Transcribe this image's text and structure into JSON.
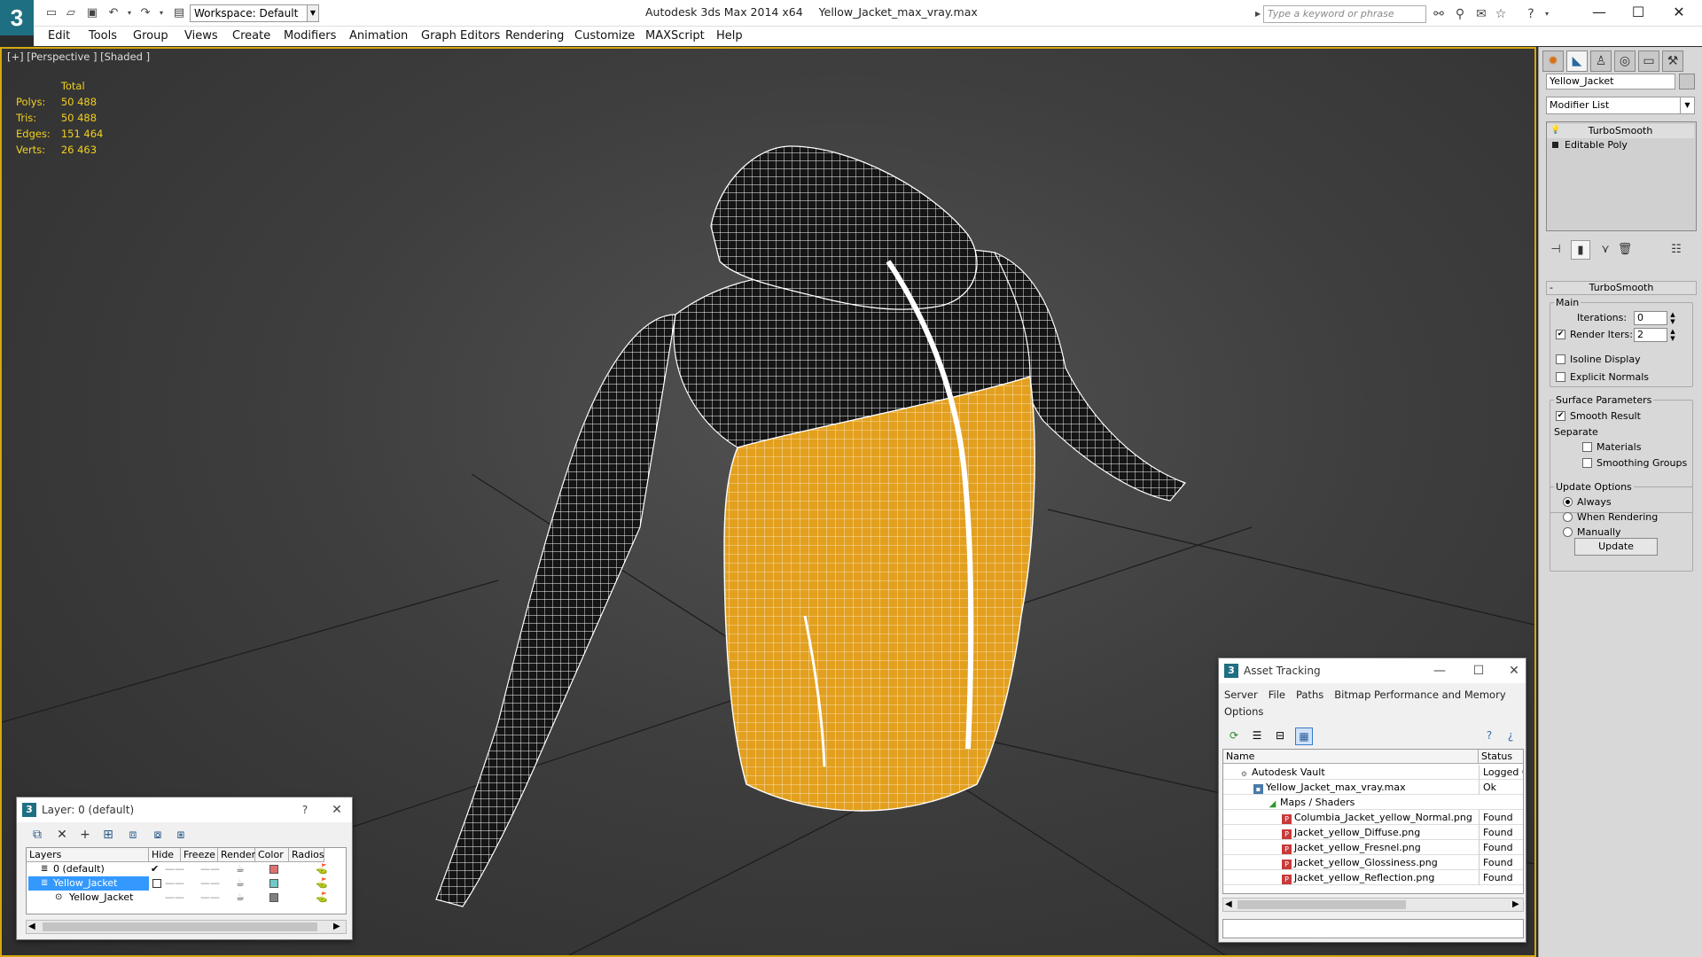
{
  "titlebar": {
    "app_name": "Autodesk 3ds Max  2014 x64",
    "file_name": "Yellow_Jacket_max_vray.max",
    "workspace": "Workspace: Default",
    "search_placeholder": "Type a keyword or phrase",
    "logo_glyph": "3"
  },
  "menu": [
    "Edit",
    "Tools",
    "Group",
    "Views",
    "Create",
    "Modifiers",
    "Animation",
    "Graph Editors",
    "Rendering",
    "Customize",
    "MAXScript",
    "Help"
  ],
  "viewport": {
    "label": "[+] [Perspective ] [Shaded ]",
    "stats": {
      "header": "Total",
      "rows": [
        {
          "label": "Polys:",
          "value": "50 488"
        },
        {
          "label": "Tris:",
          "value": "50 488"
        },
        {
          "label": "Edges:",
          "value": "151 464"
        },
        {
          "label": "Verts:",
          "value": "26 463"
        }
      ]
    },
    "accent": "#d4a810",
    "jacket_body_color": "#e3a01e"
  },
  "command_panel": {
    "object_name": "Yellow_Jacket",
    "modifier_list": "Modifier List",
    "stack": [
      "TurboSmooth",
      "Editable Poly"
    ],
    "rollout_title": "TurboSmooth",
    "main_label": "Main",
    "iterations_label": "Iterations:",
    "iterations_value": "0",
    "render_iters_label": "Render Iters:",
    "render_iters_value": "2",
    "isoline_label": "Isoline Display",
    "explicit_normals_label": "Explicit Normals",
    "surface_params_label": "Surface Parameters",
    "smooth_result_label": "Smooth Result",
    "separate_label": "Separate",
    "materials_label": "Materials",
    "smoothing_groups_label": "Smoothing Groups",
    "update_options_label": "Update Options",
    "always_label": "Always",
    "when_rendering_label": "When Rendering",
    "manually_label": "Manually",
    "update_button": "Update"
  },
  "layer_window": {
    "title": "Layer: 0 (default)",
    "help": "?",
    "columns": [
      "Layers",
      "Hide",
      "Freeze",
      "Render",
      "Color",
      "Radiosi"
    ],
    "rows": [
      {
        "name": "0 (default)",
        "color": "#e07070",
        "current": true,
        "selected": false,
        "indent": 0
      },
      {
        "name": "Yellow_Jacket",
        "color": "#70c8c8",
        "current": false,
        "selected": true,
        "indent": 0
      },
      {
        "name": "Yellow_Jacket",
        "color": "#808080",
        "current": false,
        "selected": false,
        "indent": 1
      }
    ]
  },
  "asset_window": {
    "title": "Asset Tracking",
    "menus": [
      "Server",
      "File",
      "Paths",
      "Bitmap Performance and Memory",
      "Options"
    ],
    "columns": [
      "Name",
      "Status"
    ],
    "rows": [
      {
        "name": "Autodesk Vault",
        "status": "Logged O",
        "indent": 0
      },
      {
        "name": "Yellow_Jacket_max_vray.max",
        "status": "Ok",
        "indent": 1
      },
      {
        "name": "Maps / Shaders",
        "status": "",
        "indent": 2
      },
      {
        "name": "Columbia_Jacket_yellow_Normal.png",
        "status": "Found",
        "indent": 3
      },
      {
        "name": "Jacket_yellow_Diffuse.png",
        "status": "Found",
        "indent": 3
      },
      {
        "name": "Jacket_yellow_Fresnel.png",
        "status": "Found",
        "indent": 3
      },
      {
        "name": "Jacket_yellow_Glossiness.png",
        "status": "Found",
        "indent": 3
      },
      {
        "name": "Jacket_yellow_Reflection.png",
        "status": "Found",
        "indent": 3
      }
    ]
  }
}
